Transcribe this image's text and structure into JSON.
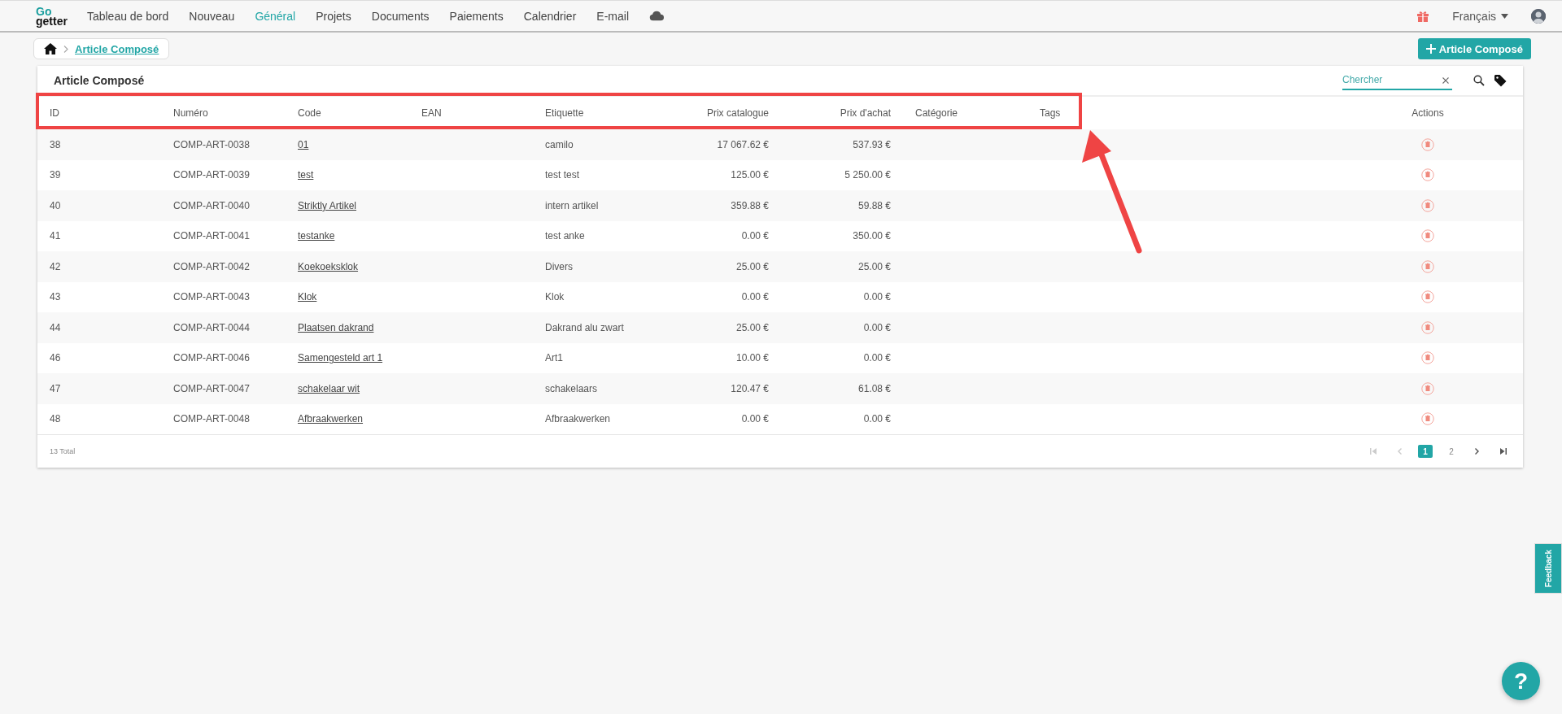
{
  "nav": {
    "logo": {
      "top": "Go",
      "bottom": "getter"
    },
    "items": [
      {
        "label": "Tableau de bord",
        "selected": false
      },
      {
        "label": "Nouveau",
        "selected": false
      },
      {
        "label": "Général",
        "selected": true
      },
      {
        "label": "Projets",
        "selected": false
      },
      {
        "label": "Documents",
        "selected": false
      },
      {
        "label": "Paiements",
        "selected": false
      },
      {
        "label": "Calendrier",
        "selected": false
      },
      {
        "label": "E-mail",
        "selected": false
      }
    ],
    "language": "Français"
  },
  "breadcrumb": {
    "current": "Article Composé"
  },
  "add_button": {
    "label": "Article Composé"
  },
  "card": {
    "title": "Article Composé",
    "search": {
      "placeholder": "Chercher"
    }
  },
  "table": {
    "columns": [
      {
        "label": "ID",
        "kind": "text"
      },
      {
        "label": "Numéro",
        "kind": "text"
      },
      {
        "label": "Code",
        "kind": "text"
      },
      {
        "label": "EAN",
        "kind": "text"
      },
      {
        "label": "Etiquette",
        "kind": "text"
      },
      {
        "label": "Prix catalogue",
        "kind": "amount"
      },
      {
        "label": "Prix d'achat",
        "kind": "amount"
      },
      {
        "label": "Catégorie",
        "kind": "text"
      },
      {
        "label": "Tags",
        "kind": "text"
      }
    ],
    "actions_label": "Actions",
    "rows": [
      {
        "id": "38",
        "number": "COMP-ART-0038",
        "code": "01",
        "label": "camilo",
        "list_price": "17 067.62 €",
        "purchase_price": "537.93 €"
      },
      {
        "id": "39",
        "number": "COMP-ART-0039",
        "code": "test",
        "label": "test test",
        "list_price": "125.00 €",
        "purchase_price": "5 250.00 €"
      },
      {
        "id": "40",
        "number": "COMP-ART-0040",
        "code": "Striktly Artikel",
        "label": "intern artikel",
        "list_price": "359.88 €",
        "purchase_price": "59.88 €"
      },
      {
        "id": "41",
        "number": "COMP-ART-0041",
        "code": "testanke",
        "label": "test anke",
        "list_price": "0.00 €",
        "purchase_price": "350.00 €"
      },
      {
        "id": "42",
        "number": "COMP-ART-0042",
        "code": "Koekoeksklok",
        "label": "Divers",
        "list_price": "25.00 €",
        "purchase_price": "25.00 €"
      },
      {
        "id": "43",
        "number": "COMP-ART-0043",
        "code": "Klok",
        "label": "Klok",
        "list_price": "0.00 €",
        "purchase_price": "0.00 €"
      },
      {
        "id": "44",
        "number": "COMP-ART-0044",
        "code": "Plaatsen dakrand",
        "label": "Dakrand alu zwart",
        "list_price": "25.00 €",
        "purchase_price": "0.00 €"
      },
      {
        "id": "46",
        "number": "COMP-ART-0046",
        "code": "Samengesteld art 1",
        "label": "Art1",
        "list_price": "10.00 €",
        "purchase_price": "0.00 €"
      },
      {
        "id": "47",
        "number": "COMP-ART-0047",
        "code": "schakelaar wit",
        "label": "schakelaars",
        "list_price": "120.47 €",
        "purchase_price": "61.08 €"
      },
      {
        "id": "48",
        "number": "COMP-ART-0048",
        "code": "Afbraakwerken",
        "label": "Afbraakwerken",
        "list_price": "0.00 €",
        "purchase_price": "0.00 €"
      }
    ]
  },
  "footer": {
    "total": "13 Total",
    "pager": {
      "first_disabled": true,
      "prev_disabled": true,
      "next_disabled": false,
      "last_disabled": false,
      "pages": [
        {
          "label": "1",
          "selected": true
        },
        {
          "label": "2",
          "selected": false
        }
      ]
    }
  },
  "feedback": "Feedback",
  "help": "?"
}
